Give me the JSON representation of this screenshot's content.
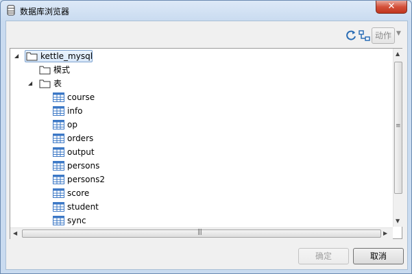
{
  "window": {
    "title": "数据库浏览器",
    "close_label": "✕"
  },
  "toolbar": {
    "action_label": "动作"
  },
  "tree": {
    "connection": "kettle_mysql",
    "schemas_label": "模式",
    "tables_label": "表",
    "tables": [
      "course",
      "info",
      "op",
      "orders",
      "output",
      "persons",
      "persons2",
      "score",
      "student",
      "sync"
    ]
  },
  "buttons": {
    "ok_label": "确定",
    "cancel_label": "取消"
  }
}
